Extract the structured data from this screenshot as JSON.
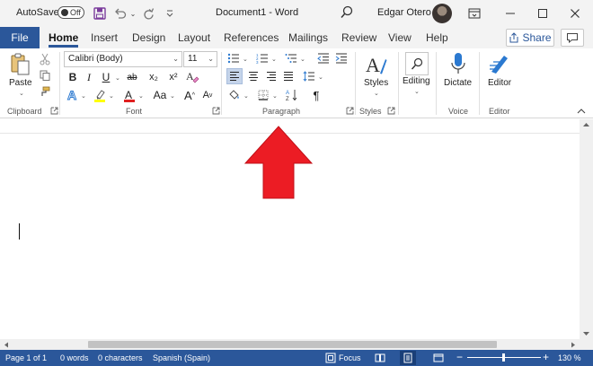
{
  "titlebar": {
    "autosave_label": "AutoSave",
    "autosave_state": "Off",
    "document_title": "Document1  -  Word",
    "user_name": "Edgar Otero"
  },
  "tabs": {
    "file": "File",
    "items": [
      "Home",
      "Insert",
      "Design",
      "Layout",
      "References",
      "Mailings",
      "Review",
      "View",
      "Help"
    ],
    "active": "Home",
    "share": "Share"
  },
  "ribbon": {
    "clipboard": {
      "paste": "Paste",
      "label": "Clipboard"
    },
    "font": {
      "name": "Calibri (Body)",
      "size": "11",
      "bold": "B",
      "italic": "I",
      "underline": "U",
      "strike": "ab",
      "subscript": "x₂",
      "superscript": "x²",
      "grow": "A",
      "shrink": "A",
      "change_case": "Aa",
      "label": "Font"
    },
    "paragraph": {
      "label": "Paragraph",
      "pilcrow": "¶"
    },
    "styles": {
      "styles": "Styles",
      "label": "Styles"
    },
    "editing": {
      "editing": "Editing"
    },
    "voice": {
      "dictate": "Dictate",
      "label": "Voice"
    },
    "editor": {
      "editor": "Editor",
      "label": "Editor"
    }
  },
  "status": {
    "page": "Page 1 of 1",
    "words": "0 words",
    "characters": "0 characters",
    "language": "Spanish (Spain)",
    "focus": "Focus",
    "zoom": "130 %"
  },
  "colors": {
    "word_blue": "#2b579a",
    "highlight_yellow": "#ffff00",
    "font_red": "#e02020",
    "arrow_red": "#ec1c24"
  }
}
